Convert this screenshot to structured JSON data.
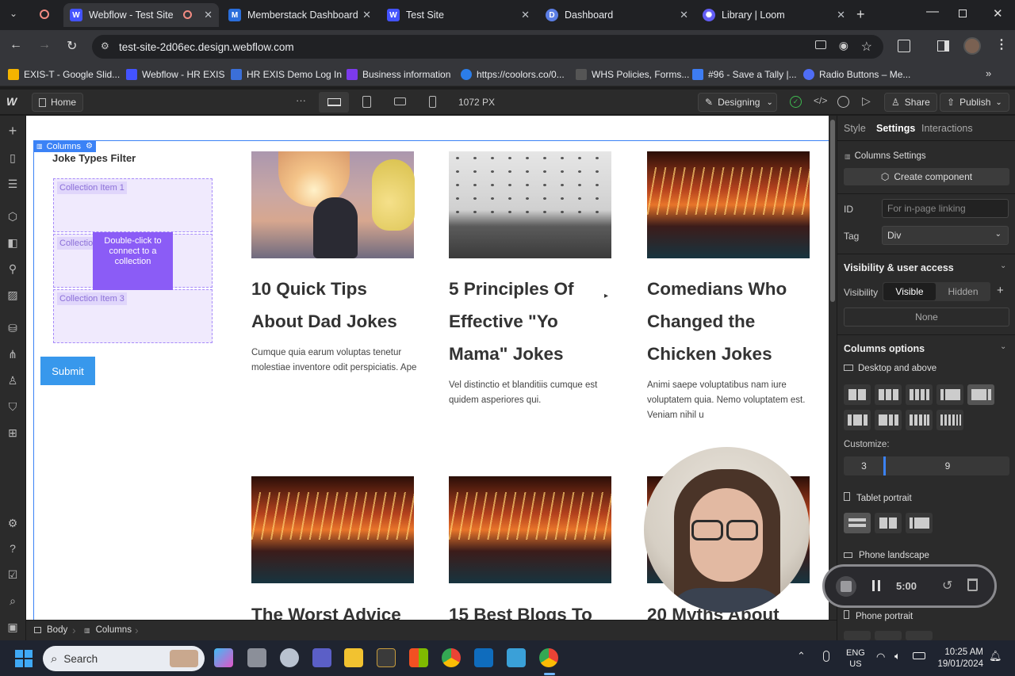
{
  "tabs": [
    {
      "label": "Webflow - Test Site",
      "icon": "W"
    },
    {
      "label": "Memberstack Dashboard",
      "icon": "M"
    },
    {
      "label": "Test Site",
      "icon": "W"
    },
    {
      "label": "Dashboard",
      "icon": "D"
    },
    {
      "label": "Library | Loom",
      "icon": "L"
    }
  ],
  "address": {
    "url": "test-site-2d06ec.design.webflow.com"
  },
  "bookmarks": [
    "EXIS-T - Google Slid...",
    "Webflow - HR EXIS",
    "HR EXIS Demo Log In",
    "Business information",
    "https://coolors.co/0...",
    "WHS Policies, Forms...",
    "#96 - Save a Tally |...",
    "Radio Buttons – Me..."
  ],
  "bookmark_colors": [
    "#f4b400",
    "#4353ff",
    "#3b6fd8",
    "#7c3aed",
    "#2b7de9",
    "#555",
    "#3d7cf2",
    "#4f6df5"
  ],
  "webflow": {
    "page": "Home",
    "width": "1072 PX",
    "mode": "Designing",
    "share": "Share",
    "publish": "Publish"
  },
  "canvas": {
    "selected_label": "Columns",
    "filter_title": "Joke Types Filter",
    "collection_items": [
      "Collection Item 1",
      "Collection Item 2",
      "Collection Item 3"
    ],
    "collection_item2_visible": "Collectio",
    "connect_tooltip": "Double-click to connect to a collection",
    "submit": "Submit",
    "cards": [
      {
        "title": "10 Quick Tips About Dad Jokes",
        "body": "Cumque quia earum voluptas tenetur molestiae inventore odit perspiciatis. Ape",
        "img": "lanterns"
      },
      {
        "title": "5 Principles Of Effective \"Yo Mama\" Jokes",
        "body": "Vel distinctio et blanditiis cumque est quidem asperiores qui.",
        "img": "birds"
      },
      {
        "title": "Comedians Who Changed the Chicken Jokes",
        "body": "Animi saepe voluptatibus nam iure voluptatem quia. Nemo voluptatem est. Veniam nihil u",
        "img": "neon"
      },
      {
        "title": "The Worst Advice",
        "body": "",
        "img": "neon"
      },
      {
        "title": "15 Best Blogs To",
        "body": "",
        "img": "neon"
      },
      {
        "title": "20 Myths About",
        "body": "",
        "img": "neon"
      }
    ]
  },
  "panel": {
    "tabs": [
      "Style",
      "Settings",
      "Interactions"
    ],
    "columns_settings": "Columns Settings",
    "create_component": "Create component",
    "id_label": "ID",
    "id_placeholder": "For in-page linking",
    "tag_label": "Tag",
    "tag_value": "Div",
    "visibility_section": "Visibility & user access",
    "visibility_label": "Visibility",
    "visible": "Visible",
    "hidden": "Hidden",
    "none": "None",
    "columns_options": "Columns options",
    "desktop": "Desktop and above",
    "customize": "Customize:",
    "col_left": "3",
    "col_right": "9",
    "tablet": "Tablet portrait",
    "phone_landscape": "Phone landscape",
    "phone_portrait": "Phone portrait"
  },
  "recorder": {
    "time": "5:00"
  },
  "breadcrumb": [
    "Body",
    "Columns"
  ],
  "taskbar": {
    "search": "Search",
    "lang1": "ENG",
    "lang2": "US",
    "time": "10:25 AM",
    "date": "19/01/2024"
  }
}
